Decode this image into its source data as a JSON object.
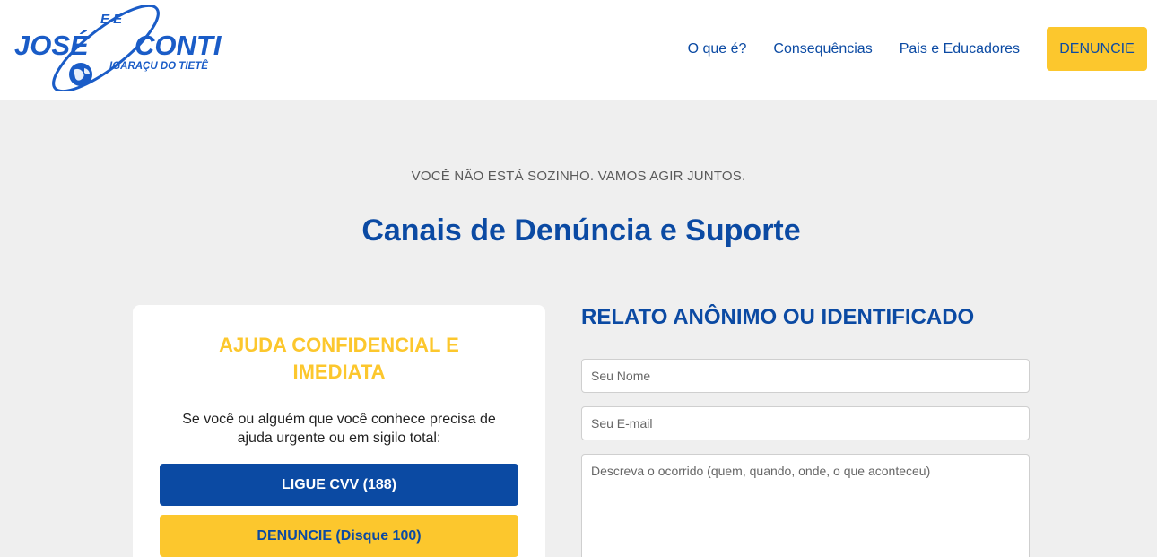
{
  "brand": {
    "prefix": "E E",
    "name_left": "JOSÉ",
    "name_right": "CONTI",
    "subtitle": "IGARAÇU DO TIETÊ",
    "color": "#1a5cc7"
  },
  "nav": {
    "items": [
      {
        "label": "O que é?"
      },
      {
        "label": "Consequências"
      },
      {
        "label": "Pais e Educadores"
      }
    ],
    "cta_label": "DENUNCIE"
  },
  "hero": {
    "eyebrow": "VOCÊ NÃO ESTÁ SOZINHO. VAMOS AGIR JUNTOS.",
    "title": "Canais de Denúncia e Suporte"
  },
  "help_card": {
    "title": "AJUDA CONFIDENCIAL E IMEDIATA",
    "text": "Se você ou alguém que você conhece precisa de ajuda urgente ou em sigilo total:",
    "primary_button": "LIGUE CVV (188)",
    "secondary_button": "DENUNCIE (Disque 100)"
  },
  "report_form": {
    "title": "RELATO ANÔNIMO OU IDENTIFICADO",
    "name_placeholder": "Seu Nome",
    "email_placeholder": "Seu E-mail",
    "description_placeholder": "Descreva o ocorrido (quem, quando, onde, o que aconteceu)"
  },
  "colors": {
    "primary": "#0b4aa3",
    "accent": "#fcc72d",
    "background": "#efefef"
  }
}
